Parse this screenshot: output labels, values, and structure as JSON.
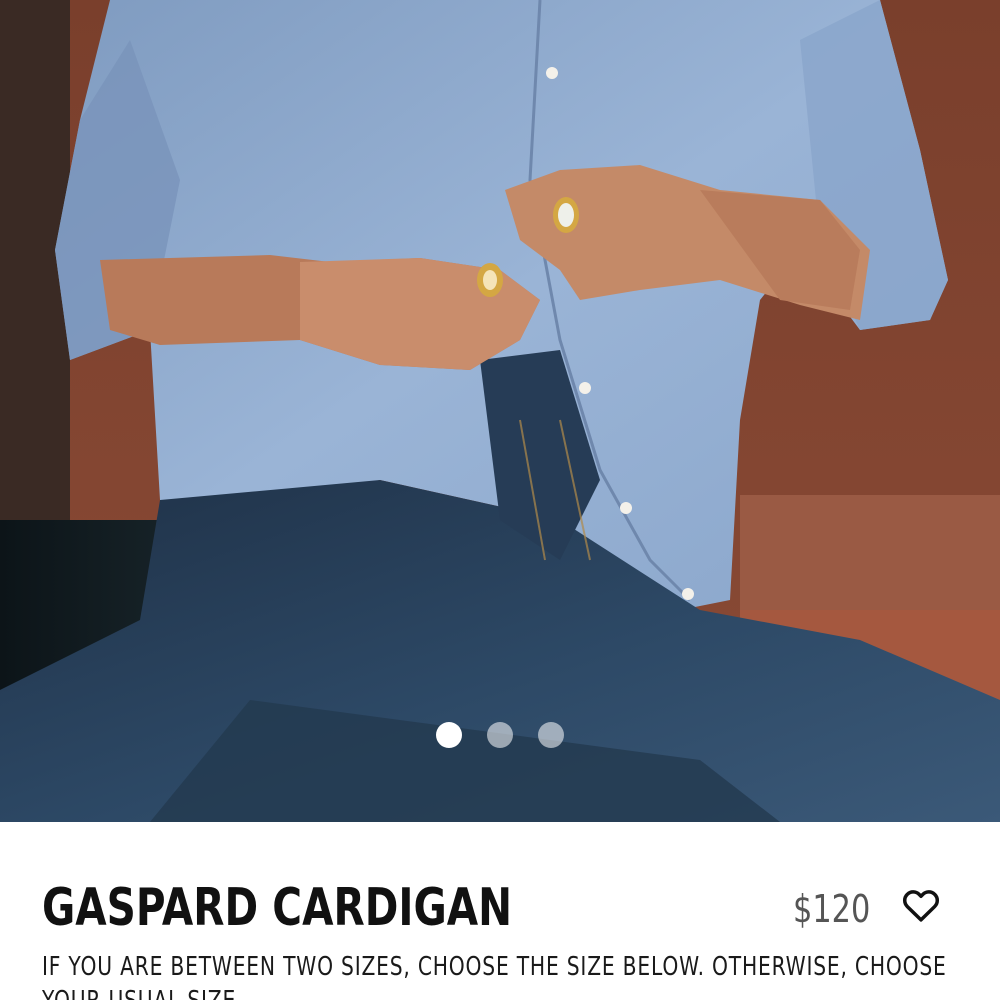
{
  "product": {
    "title": "GASPARD CARDIGAN",
    "price": "$120",
    "size_note": "IF YOU ARE BETWEEN TWO SIZES, CHOOSE THE SIZE BELOW. OTHERWISE, CHOOSE YOUR USUAL SIZE."
  },
  "carousel": {
    "slide_count": 3,
    "active_slide": 1
  },
  "icons": {
    "wishlist": "heart-outline-icon"
  },
  "colors": {
    "title": "#111111",
    "price": "#555555",
    "dot_active": "#ffffff",
    "dot_inactive": "#c7c9cc"
  }
}
